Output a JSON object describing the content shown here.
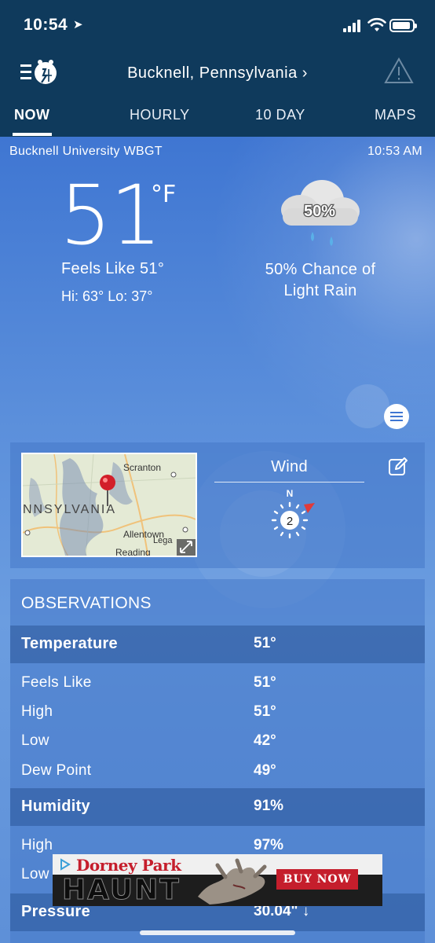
{
  "status_bar": {
    "time": "10:54"
  },
  "header": {
    "location": "Bucknell, Pennsylvania",
    "location_chevron": "›"
  },
  "tabs": [
    {
      "label": "NOW",
      "active": true
    },
    {
      "label": "HOURLY",
      "active": false
    },
    {
      "label": "10 DAY",
      "active": false
    },
    {
      "label": "MAPS",
      "active": false
    }
  ],
  "current": {
    "station": "Bucknell University WBGT",
    "updated": "10:53 AM",
    "temperature": "51",
    "unit": "°F",
    "feels_like": "Feels Like 51°",
    "hi_lo": "Hi: 63° Lo: 37°",
    "precip_badge": "50%",
    "precip_text_line1": "50% Chance of",
    "precip_text_line2": "Light Rain",
    "icon": "rain-cloud-icon"
  },
  "map": {
    "labels": {
      "scranton": "Scranton",
      "state": "NNSYLVANIA",
      "allentown": "Allentown",
      "reading": "Reading",
      "lega": "Lega"
    }
  },
  "wind": {
    "title": "Wind",
    "direction": "N",
    "speed": "2"
  },
  "observations": {
    "title": "OBSERVATIONS",
    "rows": [
      {
        "label": "Temperature",
        "value": "51°",
        "type": "header"
      },
      {
        "label": "Feels Like",
        "value": "51°",
        "type": "sub"
      },
      {
        "label": "High",
        "value": "51°",
        "type": "sub"
      },
      {
        "label": "Low",
        "value": "42°",
        "type": "sub"
      },
      {
        "label": "Dew Point",
        "value": "49°",
        "type": "sub"
      },
      {
        "label": "Humidity",
        "value": "91%",
        "type": "header"
      },
      {
        "label": "High",
        "value": "97%",
        "type": "sub"
      },
      {
        "label": "Low",
        "value": "",
        "type": "sub"
      },
      {
        "label": "Pressure",
        "value": "30.04\"  ↓",
        "type": "header"
      }
    ]
  },
  "ad": {
    "brand": "Dorney Park",
    "headline": "HAUNT",
    "cta": "BUY NOW"
  },
  "colors": {
    "header_bg": "#0f3a5c",
    "sky_top": "#3f76d2",
    "ad_red": "#c51e2c"
  }
}
